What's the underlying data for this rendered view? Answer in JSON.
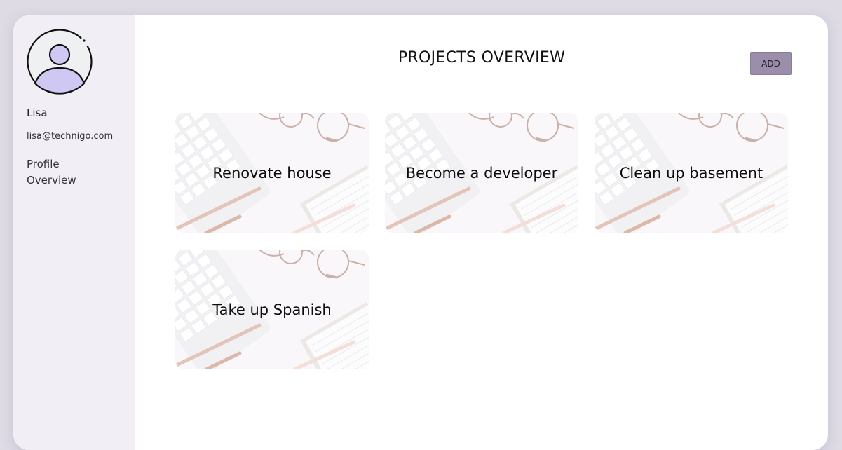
{
  "user": {
    "name": "Lisa",
    "email": "lisa@technigo.com"
  },
  "nav": {
    "profile_label": "Profile",
    "overview_label": "Overview"
  },
  "header": {
    "title": "PROJECTS OVERVIEW",
    "add_label": "ADD"
  },
  "projects": [
    {
      "title": "Renovate house"
    },
    {
      "title": "Become a developer"
    },
    {
      "title": "Clean up basement"
    },
    {
      "title": "Take up Spanish"
    }
  ],
  "colors": {
    "background": "#dedbe5",
    "sidebar": "#f1eef5",
    "accent_button": "#9b8eab",
    "avatar_fill": "#cfc8f2"
  }
}
